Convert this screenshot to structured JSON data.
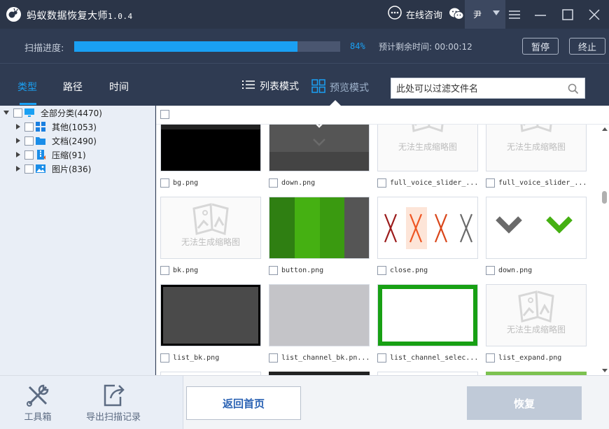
{
  "titlebar": {
    "app_name": "蚂蚁数据恢复大师",
    "version": "1.0.4",
    "consult_label": "在线咨询",
    "user_name": "尹"
  },
  "progress": {
    "label": "扫描进度:",
    "percent_value": 0.84,
    "percent_text": "84%",
    "remaining": "预计剩余时间: 00:00:12",
    "pause_label": "暂停",
    "stop_label": "终止"
  },
  "tabs": {
    "type": "类型",
    "path": "路径",
    "time": "时间"
  },
  "view_modes": {
    "list": "列表模式",
    "preview": "预览模式"
  },
  "search": {
    "placeholder": "此处可以过滤文件名"
  },
  "tree": {
    "root": "全部分类(4470)",
    "items": [
      {
        "label": "其他(1053)",
        "icon": "grid-icon"
      },
      {
        "label": "文档(2490)",
        "icon": "folder-icon"
      },
      {
        "label": "压缩(91)",
        "icon": "archive-icon"
      },
      {
        "label": "图片(836)",
        "icon": "image-icon"
      }
    ]
  },
  "no_thumb_text": "无法生成缩略图",
  "files": [
    {
      "name": "bg.png"
    },
    {
      "name": "down.png"
    },
    {
      "name": "full_voice_slider_..."
    },
    {
      "name": "full_voice_slider_..."
    },
    {
      "name": "bk.png"
    },
    {
      "name": "button.png"
    },
    {
      "name": "close.png"
    },
    {
      "name": "down.png"
    },
    {
      "name": "list_bk.png"
    },
    {
      "name": "list_channel_bk.pn..."
    },
    {
      "name": "list_channel_selec..."
    },
    {
      "name": "list_expand.png"
    }
  ],
  "bottom": {
    "toolbox_label": "工具箱",
    "export_label": "导出扫描记录",
    "home_label": "返回首页",
    "recover_label": "恢复"
  },
  "colors": {
    "accent": "#1aa0f3",
    "header_bg": "#2f3b52",
    "green": "#3aa10e"
  }
}
